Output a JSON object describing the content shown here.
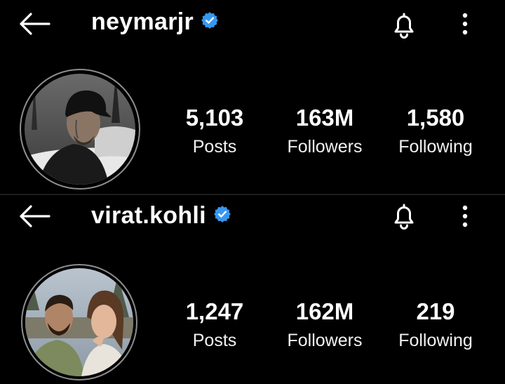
{
  "profiles": [
    {
      "username": "neymarjr",
      "verified": true,
      "stats": [
        {
          "value": "5,103",
          "label": "Posts"
        },
        {
          "value": "163M",
          "label": "Followers"
        },
        {
          "value": "1,580",
          "label": "Following"
        }
      ]
    },
    {
      "username": "virat.kohli",
      "verified": true,
      "stats": [
        {
          "value": "1,247",
          "label": "Posts"
        },
        {
          "value": "162M",
          "label": "Followers"
        },
        {
          "value": "219",
          "label": "Following"
        }
      ]
    }
  ],
  "icons": {
    "back": "arrow-left-icon",
    "verified": "verified-badge-icon",
    "notifications": "bell-icon",
    "more": "more-vertical-icon"
  },
  "colors": {
    "background": "#000000",
    "verified_badge": "#3897f0",
    "text": "#ffffff"
  }
}
